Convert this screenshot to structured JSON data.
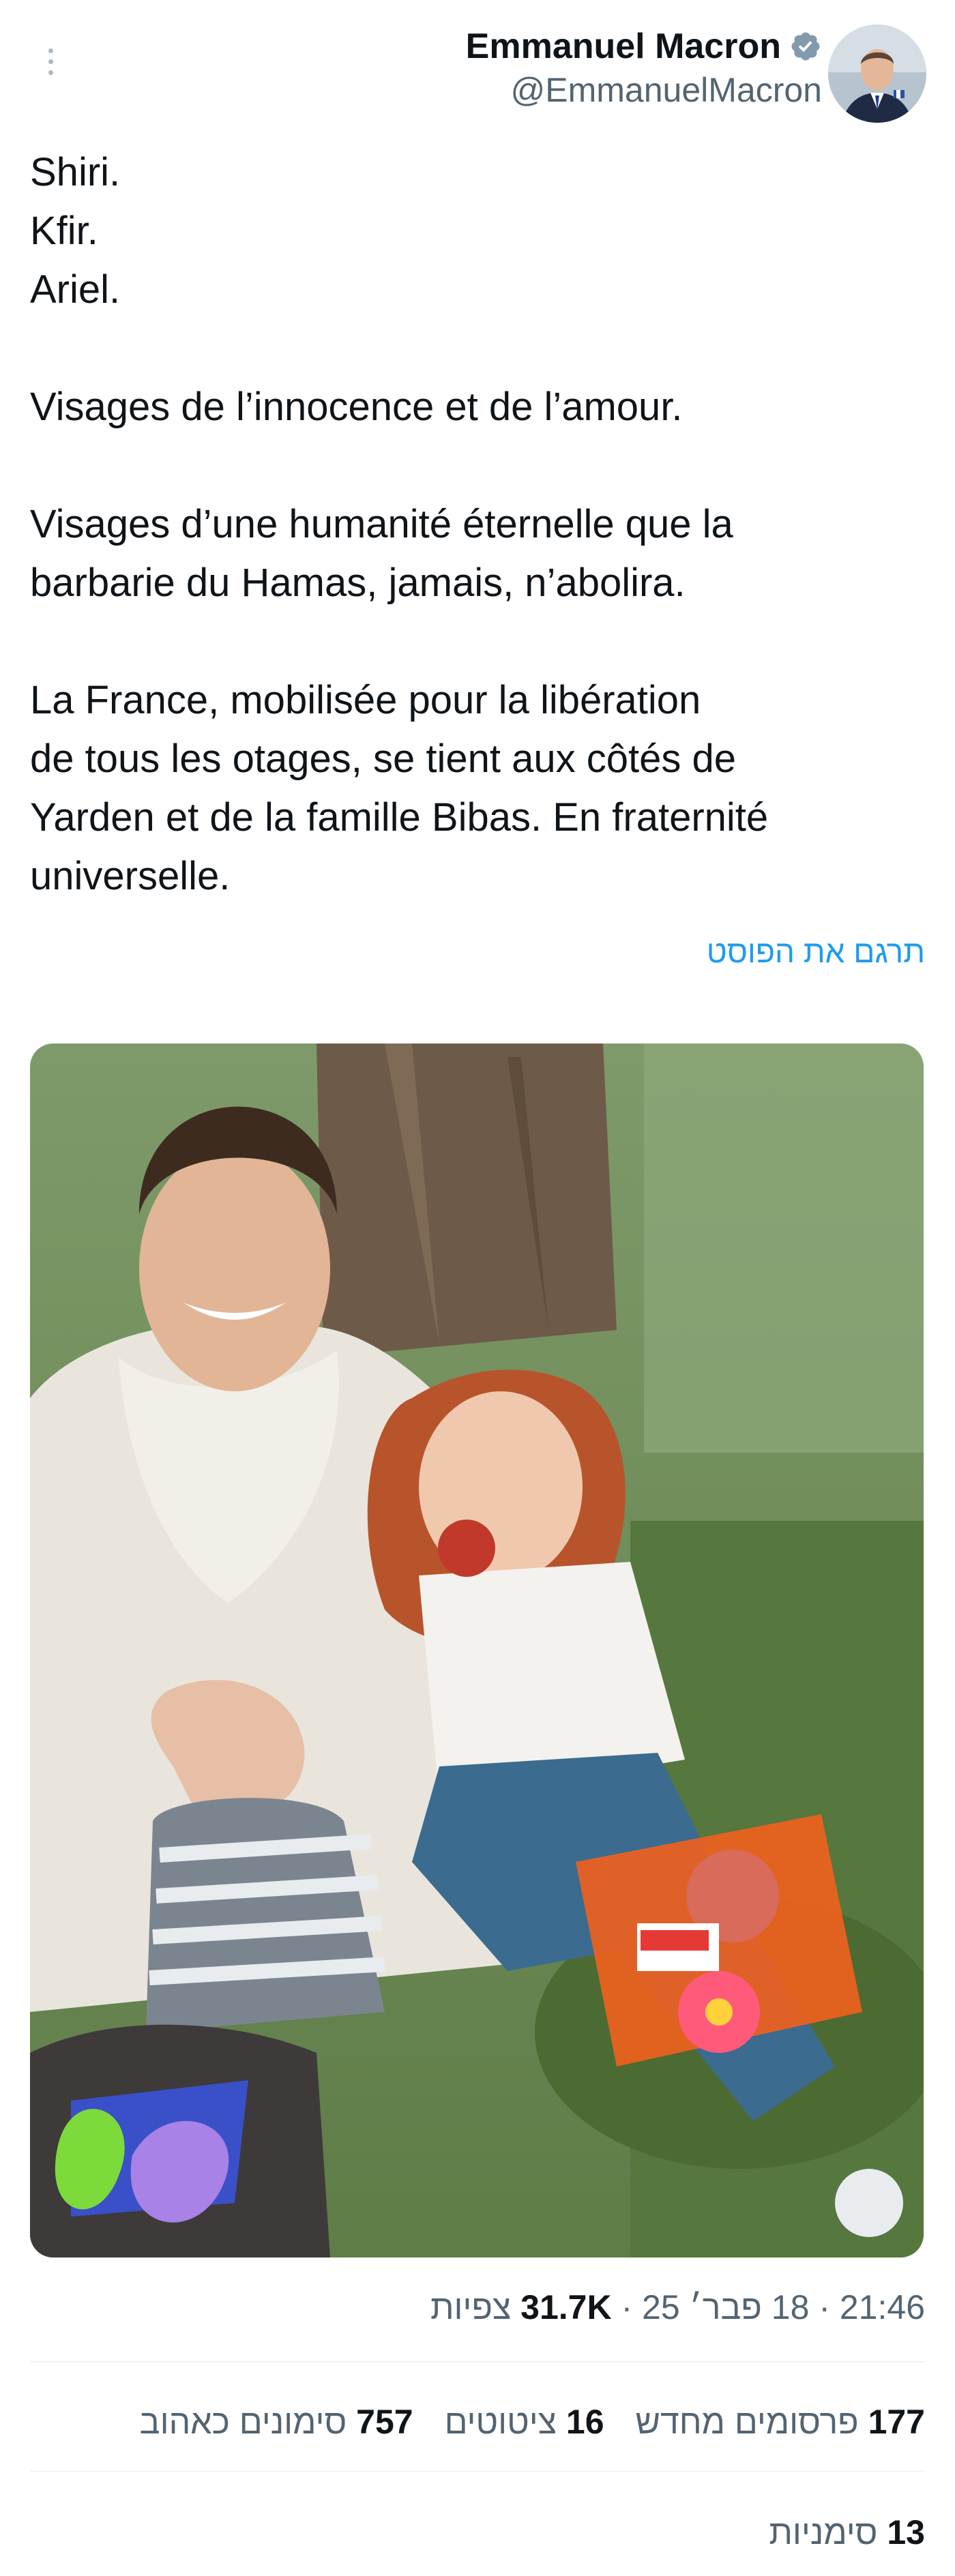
{
  "author": {
    "name": "Emmanuel Macron",
    "handle": "@EmmanuelMacron",
    "verified_icon": "verified-badge-icon"
  },
  "post": {
    "lines": [
      "Shiri.",
      "Kfir.",
      "Ariel.",
      "",
      "Visages de l’innocence et de l’amour.",
      "",
      "Visages d’une humanité éternelle que la",
      "barbarie du Hamas, jamais, n’abolira.",
      "",
      "La France, mobilisée pour la libération",
      "de tous les otages, se tient aux côtés de",
      "Yarden et de la famille Bibas. En fraternité",
      "universelle."
    ],
    "translate_label": "תרגם את הפוסט"
  },
  "meta": {
    "time": "21:46",
    "date": "18 פבר׳ 25",
    "views_count": "31.7K",
    "views_label": "צפיות"
  },
  "stats": {
    "reposts_count": "177",
    "reposts_label": "פרסומים מחדש",
    "quotes_count": "16",
    "quotes_label": "ציטוטים",
    "likes_count": "757",
    "likes_label": "סימונים כאהוב",
    "bookmarks_count": "13",
    "bookmarks_label": "סימניות"
  },
  "colors": {
    "link": "#1d9bf0",
    "verified": "#829aab",
    "secondary_text": "#536471",
    "primary_text": "#0f1419"
  }
}
